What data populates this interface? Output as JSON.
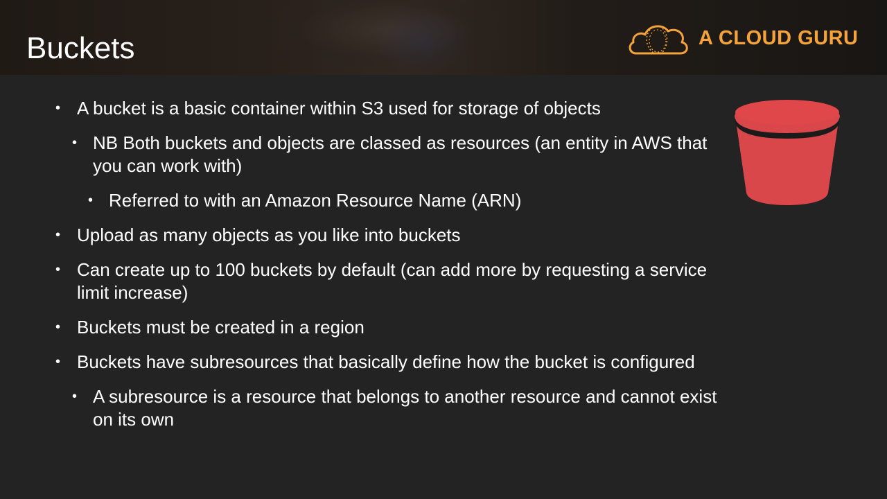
{
  "slide": {
    "title": "Buckets"
  },
  "logo": {
    "text": "A CLOUD GURU",
    "icon": "cloud-logo-icon",
    "color": "#f5a33a"
  },
  "bucket_image": {
    "icon": "s3-bucket-icon",
    "color": "#d9474b"
  },
  "bullets": [
    {
      "level": 1,
      "text": "A bucket is a basic container within S3 used for storage of objects"
    },
    {
      "level": 2,
      "text": "NB Both buckets and objects are classed as resources (an entity in AWS that you can work with)"
    },
    {
      "level": 3,
      "text": "Referred to with an Amazon Resource Name (ARN)"
    },
    {
      "level": 1,
      "text": "Upload as many objects as you like into buckets"
    },
    {
      "level": 1,
      "text": "Can create up to 100 buckets by default (can add more by requesting a service limit increase)"
    },
    {
      "level": 1,
      "text": "Buckets must be created in a region"
    },
    {
      "level": 1,
      "text": "Buckets have subresources that basically define how the bucket is configured"
    },
    {
      "level": 2,
      "text": "A subresource is a resource that belongs to another resource and cannot exist on its own"
    }
  ],
  "bullet_glyph": "•"
}
